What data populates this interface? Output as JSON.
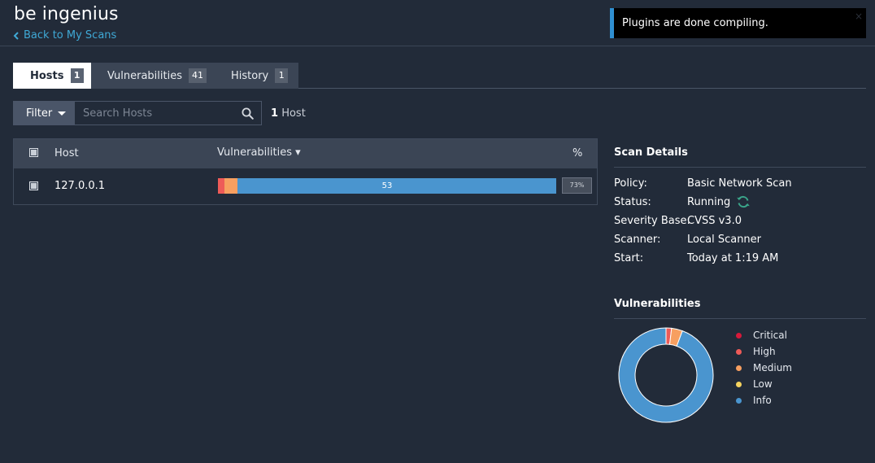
{
  "header": {
    "title": "be ingenius",
    "back_label": "Back to My Scans"
  },
  "toast": {
    "message": "Plugins are done compiling.",
    "close": "×"
  },
  "tabs": [
    {
      "label": "Hosts",
      "count": "1",
      "active": true
    },
    {
      "label": "Vulnerabilities",
      "count": "41",
      "active": false
    },
    {
      "label": "History",
      "count": "1",
      "active": false
    }
  ],
  "filter": {
    "button_label": "Filter",
    "search_placeholder": "Search Hosts",
    "count_number": "1",
    "count_label": "Host"
  },
  "table": {
    "columns": {
      "host": "Host",
      "vulnerabilities": "Vulnerabilities ▾",
      "percent": "%"
    },
    "rows": [
      {
        "host": "127.0.0.1",
        "vuln_count_label": "53",
        "percent": "73%",
        "severity_breakdown": {
          "critical": 0,
          "high": 1,
          "medium": 2,
          "low": 0,
          "info": 50
        }
      }
    ]
  },
  "scan_details": {
    "title": "Scan Details",
    "items": [
      {
        "label": "Policy:",
        "value": "Basic Network Scan"
      },
      {
        "label": "Status:",
        "value": "Running"
      },
      {
        "label": "Severity Base:",
        "value": "CVSS v3.0"
      },
      {
        "label": "Scanner:",
        "value": "Local Scanner"
      },
      {
        "label": "Start:",
        "value": "Today at 1:19 AM"
      }
    ]
  },
  "vulnerabilities_panel": {
    "title": "Vulnerabilities",
    "legend": [
      {
        "label": "Critical",
        "color": "#d7193a"
      },
      {
        "label": "High",
        "color": "#ee5b58"
      },
      {
        "label": "Medium",
        "color": "#f79f60"
      },
      {
        "label": "Low",
        "color": "#f5d35f"
      },
      {
        "label": "Info",
        "color": "#4a95cf"
      }
    ],
    "distribution": {
      "critical": 0,
      "high": 1,
      "medium": 2,
      "low": 0,
      "info": 50
    }
  },
  "colors": {
    "background": "#222b39",
    "accent": "#3fa9d6",
    "toast_border": "#2f8fd1"
  }
}
